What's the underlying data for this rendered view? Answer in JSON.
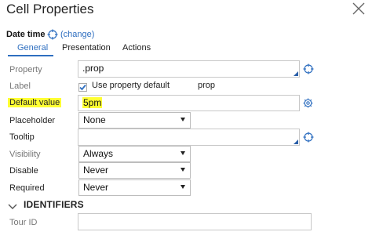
{
  "dialog": {
    "title": "Cell Properties"
  },
  "header": {
    "datetime_label": "Date time",
    "change_link": "(change)"
  },
  "tabs": [
    {
      "label": "General",
      "active": true
    },
    {
      "label": "Presentation",
      "active": false
    },
    {
      "label": "Actions",
      "active": false
    }
  ],
  "form": {
    "property": {
      "label": "Property",
      "value": ".prop"
    },
    "label": {
      "label": "Label",
      "checkbox_label": "Use property default",
      "checked": true,
      "default_text": "prop"
    },
    "default_value": {
      "label": "Default value",
      "value": "5pm"
    },
    "placeholder": {
      "label": "Placeholder",
      "value": "None"
    },
    "tooltip": {
      "label": "Tooltip",
      "value": ""
    },
    "visibility": {
      "label": "Visibility",
      "value": "Always"
    },
    "disable": {
      "label": "Disable",
      "value": "Never"
    },
    "required": {
      "label": "Required",
      "value": "Never"
    }
  },
  "identifiers": {
    "section_title": "IDENTIFIERS",
    "tour_id": {
      "label": "Tour ID",
      "value": ""
    }
  },
  "colors": {
    "accent": "#2f6fc0",
    "highlight": "#ffff33",
    "border": "#c8c8c8"
  },
  "icons": [
    "close-icon",
    "crosshair-icon",
    "gear-icon",
    "checkbox-checked-icon",
    "chevron-down-icon"
  ]
}
